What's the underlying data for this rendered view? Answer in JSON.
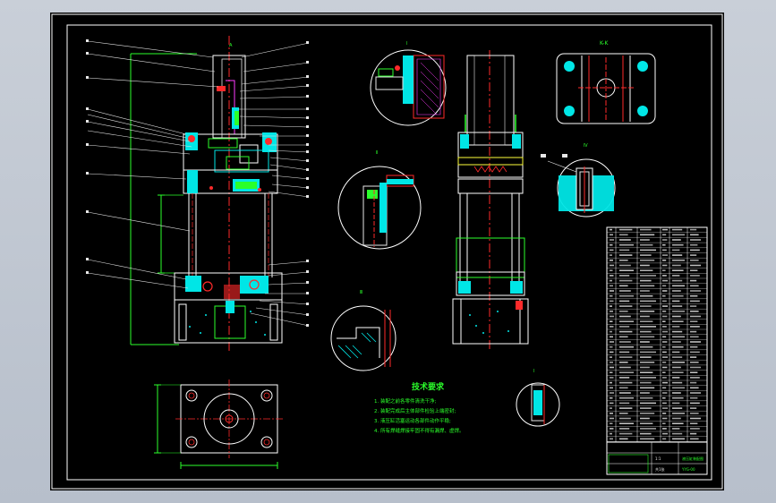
{
  "colors": {
    "background": "#000000",
    "outer_bg": "#c3c9d3",
    "border": "#ffffff",
    "red": "#ff2a2a",
    "green": "#2bff2b",
    "cyan": "#00e6e6",
    "yellow": "#ffff3c",
    "magenta": "#ff3cff",
    "blue": "#3c6cff",
    "label_white": "#e8e8e8"
  },
  "tech_requirements": {
    "title": "技术要求",
    "items": [
      "1. 装配之前各零件清洗干净;",
      "2. 装配完成后主体部件检验上端密封;",
      "3. 液压缸活塞运动各部件动作平稳;",
      "4. 所有焊缝焊接牢固不得有漏焊、虚焊。"
    ]
  },
  "title_block": {
    "drawing_name": "液压缸装配图",
    "drawing_number": "YYG-00",
    "scale": "1:1",
    "sheet": "共1张"
  },
  "view_labels": {
    "top_right": "K-K",
    "detail_small": "Ⅰ"
  }
}
